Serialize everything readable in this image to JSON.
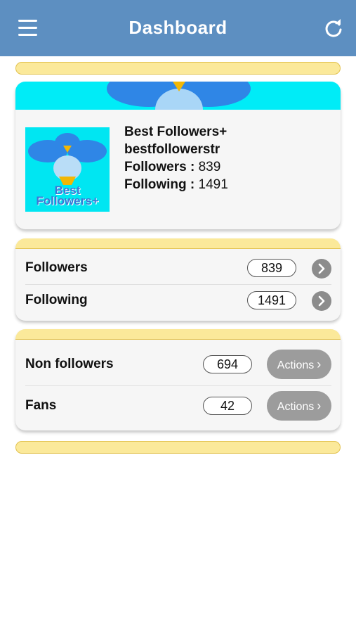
{
  "appbar": {
    "title": "Dashboard",
    "menu_icon": "menu-icon",
    "refresh_icon": "refresh-icon",
    "background": "#5d8fc1"
  },
  "profile": {
    "name": "Best Followers+",
    "username": "bestfollowerstr",
    "followers_label": "Followers :",
    "followers_value": "839",
    "following_label": "Following :",
    "following_value": "1491",
    "avatar_text_line1": "Best",
    "avatar_text_line2": "Followers+"
  },
  "stats": {
    "followers_label": "Followers",
    "followers_count": "839",
    "following_label": "Following",
    "following_count": "1491"
  },
  "analysis": {
    "non_followers_label": "Non followers",
    "non_followers_count": "694",
    "fans_label": "Fans",
    "fans_count": "42",
    "action_label": "Actions"
  },
  "colors": {
    "banner": "#00ecf7",
    "strip": "#fbe99a",
    "strip_border": "#e2c24f",
    "bird": "#2f86e6"
  }
}
